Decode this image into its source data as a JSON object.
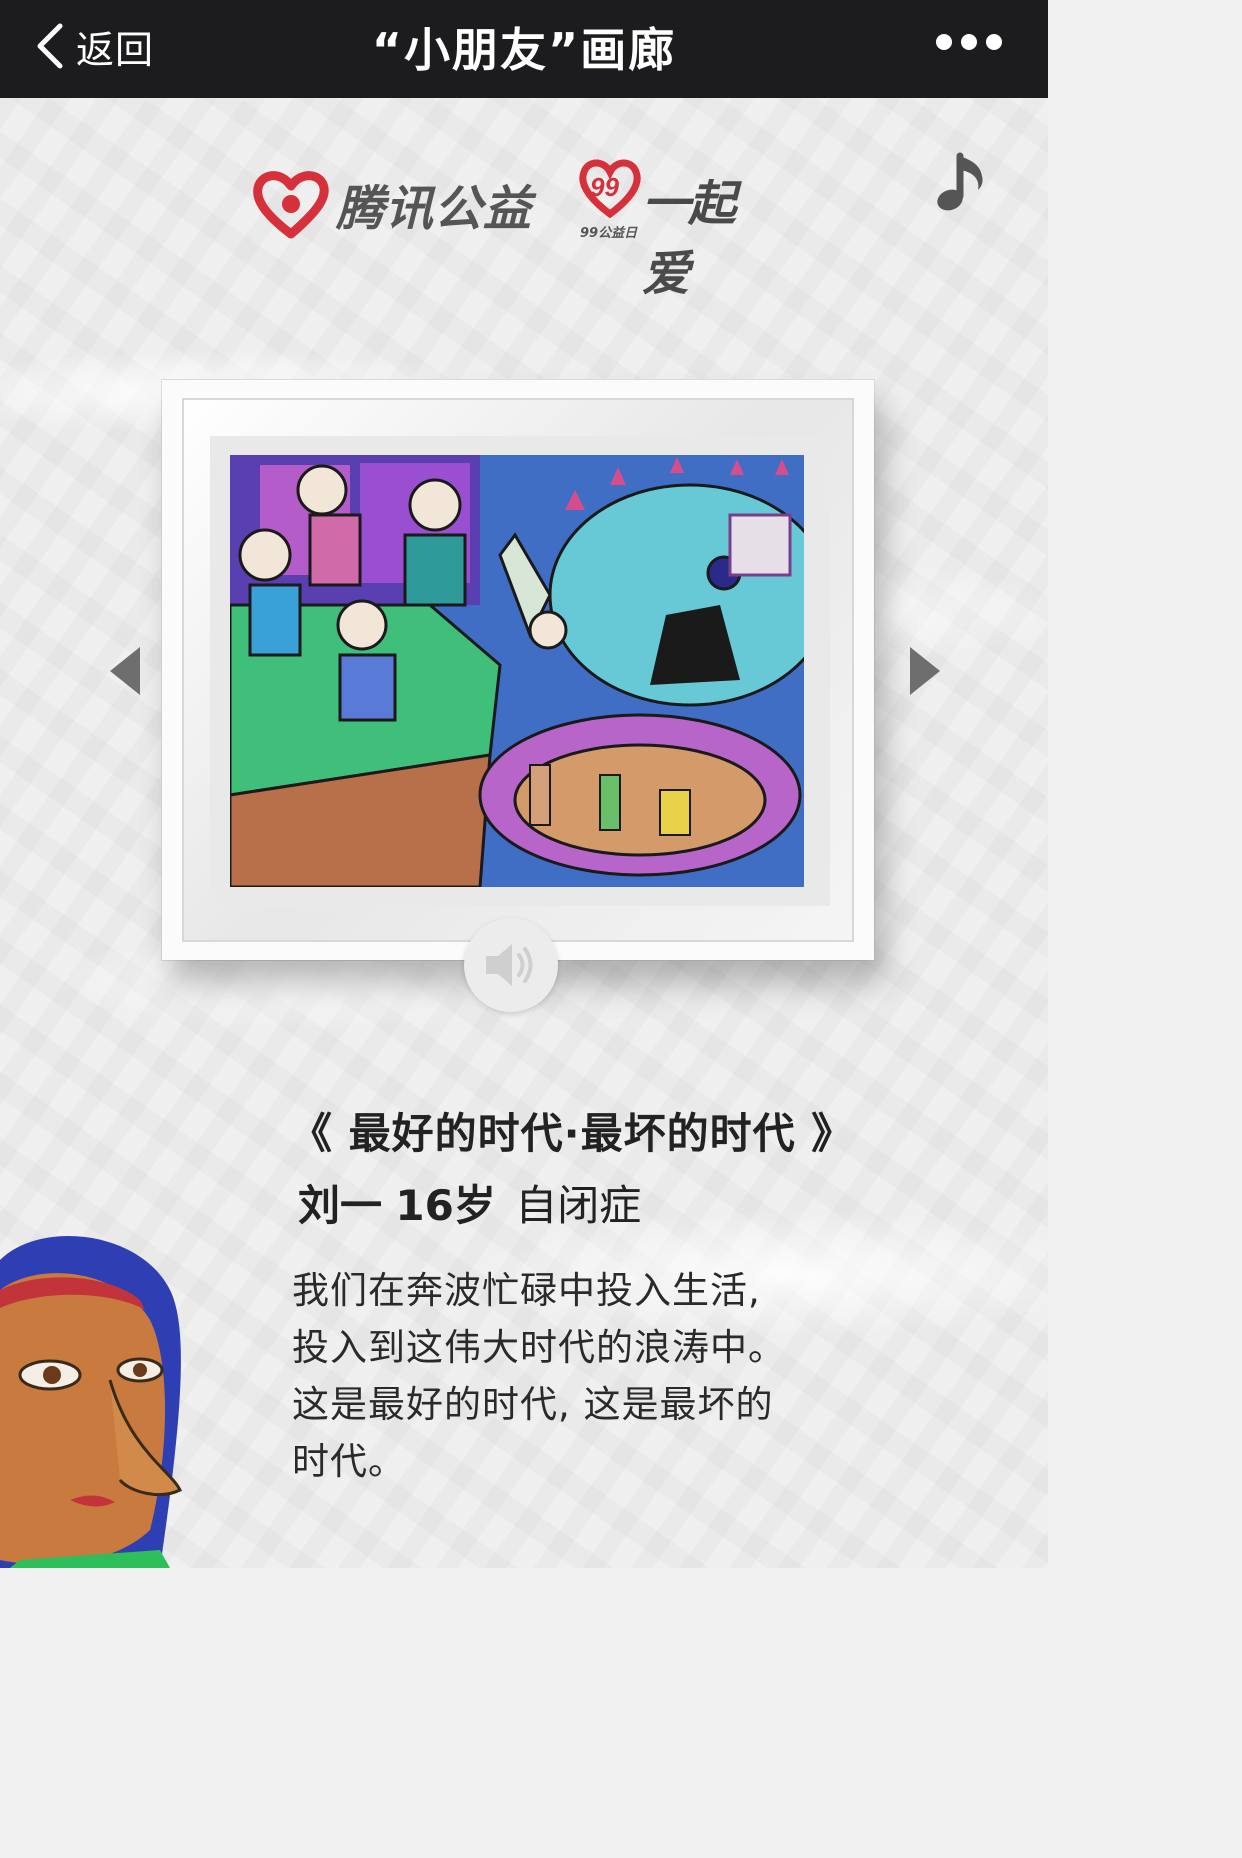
{
  "nav": {
    "back_label": "返回",
    "title": "“小朋友”画廊"
  },
  "logos": {
    "tencent": "腾讯公益",
    "day99_small": "99公益日",
    "day99_big": "一起爱"
  },
  "artwork": {
    "title": "《 最好的时代·最坏的时代 》",
    "artist_name": "刘一",
    "age": "16岁",
    "condition": "自闭症",
    "description_lines": [
      "我们在奔波忙碌中投入生活,",
      "投入到这伟大时代的浪涛中。",
      "这是最好的时代, 这是最坏的",
      "时代。"
    ]
  },
  "colors": {
    "navbar_bg": "#1c1c1e",
    "brand_red": "#d6303a",
    "text": "#222222"
  },
  "icons": [
    "back-chevron-icon",
    "more-dots-icon",
    "music-note-icon",
    "prev-arrow-icon",
    "next-arrow-icon",
    "speaker-icon"
  ]
}
